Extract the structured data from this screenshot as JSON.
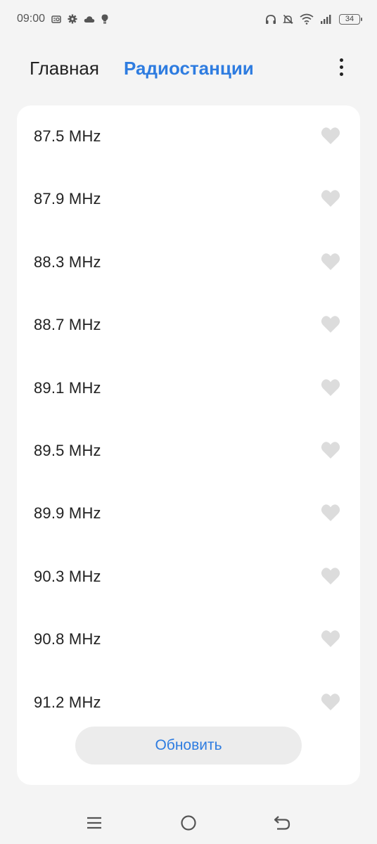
{
  "status_bar": {
    "time": "09:00",
    "battery": "34",
    "left_icons": [
      "radio-icon",
      "gear-icon",
      "cloud-icon",
      "lightbulb-icon"
    ],
    "right_icons": [
      "headphones-icon",
      "bell-muted-icon",
      "wifi-icon",
      "signal-icon",
      "battery-icon"
    ]
  },
  "header": {
    "tabs": [
      {
        "label": "Главная",
        "active": false
      },
      {
        "label": "Радиостанции",
        "active": true
      }
    ],
    "menu_icon": "more-vertical-icon"
  },
  "stations": [
    {
      "frequency": "87.5 MHz",
      "favorite": false
    },
    {
      "frequency": "87.9 MHz",
      "favorite": false
    },
    {
      "frequency": "88.3 MHz",
      "favorite": false
    },
    {
      "frequency": "88.7 MHz",
      "favorite": false
    },
    {
      "frequency": "89.1 MHz",
      "favorite": false
    },
    {
      "frequency": "89.5 MHz",
      "favorite": false
    },
    {
      "frequency": "89.9 MHz",
      "favorite": false
    },
    {
      "frequency": "90.3 MHz",
      "favorite": false
    },
    {
      "frequency": "90.8 MHz",
      "favorite": false
    },
    {
      "frequency": "91.2 MHz",
      "favorite": false
    }
  ],
  "refresh_button": {
    "label": "Обновить"
  },
  "nav_bar": {
    "icons": [
      "menu-icon",
      "home-circle-icon",
      "back-icon"
    ]
  },
  "colors": {
    "accent": "#2e7ce0",
    "heart": "#dcdcdc",
    "background": "#f4f4f4",
    "card": "#ffffff"
  }
}
